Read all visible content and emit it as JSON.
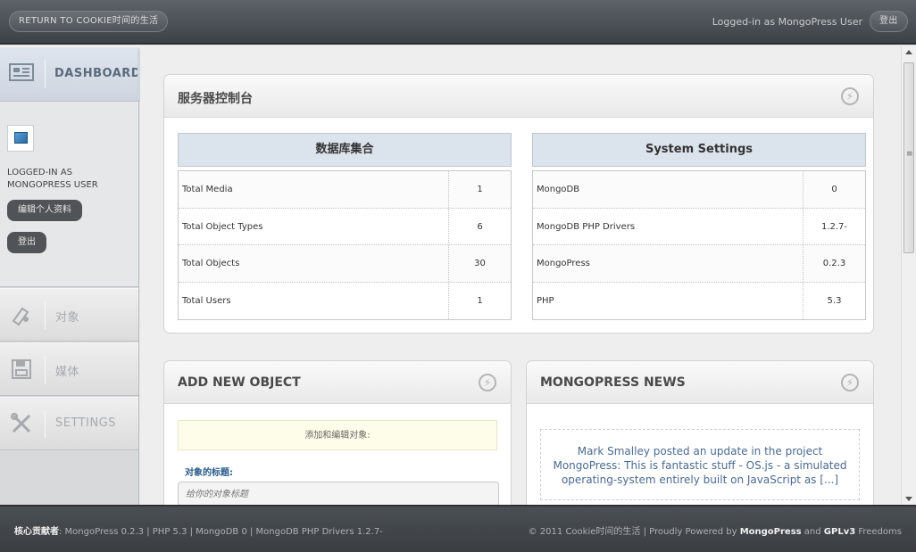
{
  "topbar": {
    "return_label": "RETURN TO COOKIE时间的生活",
    "logged_in_text": "Logged-in as MongoPress User",
    "logout_label": "登出"
  },
  "sidebar": {
    "dashboard_label": "DASHBOARD",
    "logged_as_line1": "LOGGED-IN AS",
    "logged_as_line2": "MONGOPRESS USER",
    "edit_profile_label": "编辑个人资料",
    "logout_label": "登出",
    "items": [
      {
        "label": "对象",
        "icon": "objects-icon"
      },
      {
        "label": "媒体",
        "icon": "media-icon"
      },
      {
        "label": "SETTINGS",
        "icon": "settings-icon"
      }
    ]
  },
  "server_panel": {
    "title": "服务器控制台",
    "db_table": {
      "header": "数据库集合",
      "rows": [
        {
          "key": "Total Media",
          "value": "1"
        },
        {
          "key": "Total Object Types",
          "value": "6"
        },
        {
          "key": "Total Objects",
          "value": "30"
        },
        {
          "key": "Total Users",
          "value": "1"
        }
      ]
    },
    "sys_table": {
      "header": "System Settings",
      "rows": [
        {
          "key": "MongoDB",
          "value": "0"
        },
        {
          "key": "MongoDB PHP Drivers",
          "value": "1.2.7-"
        },
        {
          "key": "MongoPress",
          "value": "0.2.3"
        },
        {
          "key": "PHP",
          "value": "5.3"
        }
      ]
    }
  },
  "add_panel": {
    "title": "ADD NEW OBJECT",
    "hint": "添加和编辑对象:",
    "title_label": "对象的标题:",
    "title_placeholder": "给你的对象标题"
  },
  "news_panel": {
    "title": "MONGOPRESS NEWS",
    "text": "Mark Smalley posted an update in the project MongoPress: This is fantastic stuff - OS.js - a simulated operating-system entirely built on JavaScript as [...]"
  },
  "footer": {
    "left_bold": "核心贡献者",
    "left_text": ": MongoPress 0.2.3 | PHP 5.3 | MongoDB 0 | MongoDB PHP Drivers 1.2.7-",
    "right_prefix": "© 2011 Cookie时间的生活 | Proudly Powered by ",
    "right_brand": "MongoPress",
    "right_and": " and ",
    "right_license": "GPLv3",
    "right_suffix": " Freedoms"
  },
  "colors": {
    "topbar": "#4a4f54",
    "dashboard_active": "#cdd5e0",
    "table_header": "#dbe3ec",
    "news_link": "#4a6a90"
  }
}
